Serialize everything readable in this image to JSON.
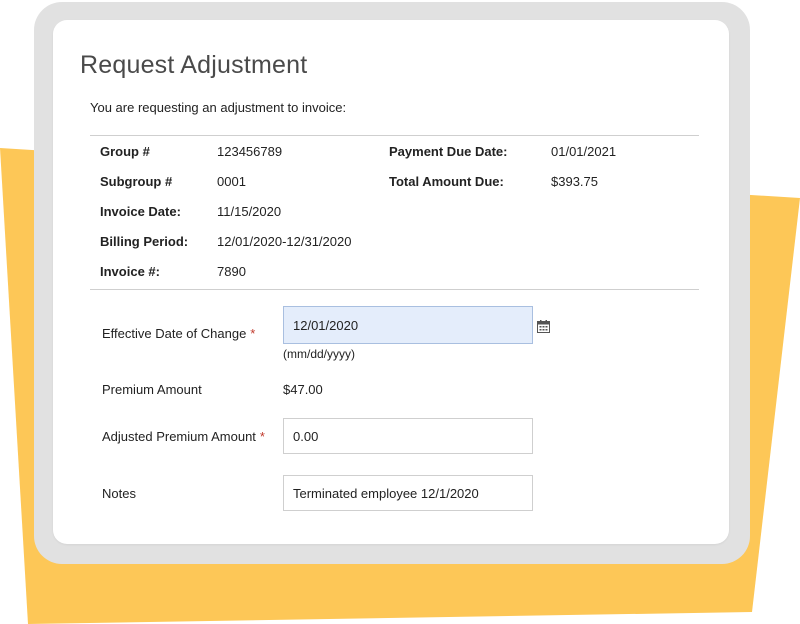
{
  "dialog": {
    "title": "Request Adjustment",
    "intro": "You are requesting an adjustment to invoice:"
  },
  "invoice_info": {
    "group_label": "Group #",
    "group_value": "123456789",
    "subgroup_label": "Subgroup #",
    "subgroup_value": "0001",
    "invoice_date_label": "Invoice Date:",
    "invoice_date_value": "11/15/2020",
    "billing_period_label": "Billing Period:",
    "billing_period_value": "12/01/2020-12/31/2020",
    "invoice_number_label": "Invoice #:",
    "invoice_number_value": "7890",
    "payment_due_label": "Payment Due Date:",
    "payment_due_value": "01/01/2021",
    "total_due_label": "Total Amount Due:",
    "total_due_value": "$393.75"
  },
  "form": {
    "effective_date_label": "Effective Date of Change",
    "effective_date_value": "12/01/2020",
    "date_format_hint": "(mm/dd/yyyy)",
    "premium_label": "Premium Amount",
    "premium_value": "$47.00",
    "adjusted_premium_label": "Adjusted Premium Amount",
    "adjusted_premium_value": "0.00",
    "notes_label": "Notes",
    "notes_value": "Terminated employee 12/1/2020",
    "required_marker": "*"
  },
  "icons": {
    "calendar": "calendar-icon"
  },
  "colors": {
    "accent_yellow": "#fdc757",
    "frame_gray": "#e1e1e1",
    "active_input_bg": "#e4edfb",
    "required_red": "#c0392b"
  }
}
